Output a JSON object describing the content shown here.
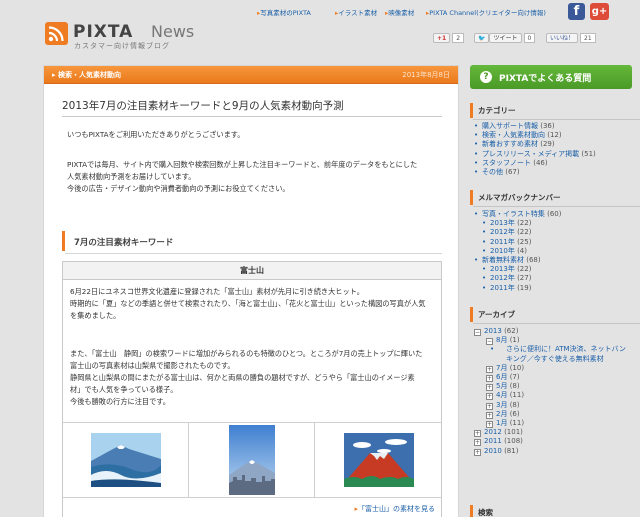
{
  "header": {
    "logo_text": "PIXTA",
    "logo_news": "News",
    "logo_sub": "カスタマー向け情報ブログ",
    "nav": [
      "写真素材のPIXTA",
      "イラスト素材",
      "映像素材",
      "PIXTA Channel(クリエイター向け情報)"
    ],
    "social": {
      "gplus_label": "+1",
      "gplus_count": "2",
      "tweet_label": "ツイート",
      "tweet_count": "0",
      "like_label": "いいね！",
      "like_count": "21"
    }
  },
  "article": {
    "category": "検索・人気素材動向",
    "date": "2013年8月8日",
    "title": "2013年7月の注目素材キーワードと9月の人気素材動向予測",
    "intro": [
      "いつもPIXTAをご利用いただきありがとうございます。"
    ],
    "body": [
      "PIXTAでは毎月、サイト内で購入回数や検索回数が上昇した注目キーワードと、前年度のデータをもとにした",
      "人気素材動向予測をお届けしています。",
      "今後の広告・デザイン動向や消費者動向の予測にお役立てください。"
    ],
    "section_title": "7月の注目素材キーワード",
    "box": {
      "heading": "富士山",
      "para1": [
        "6月22日にユネスコ世界文化遺産に登録された「富士山」素材が先月に引き続き大ヒット。",
        "時期的に「夏」などの季語と併せて検索されたり、「海と富士山」、「花火と富士山」といった構図の写真が人気",
        "を集めました。"
      ],
      "para2": [
        "また、「富士山　静岡」の検索ワードに増加がみられるのも特徴のひとつ。ところが7月の売上トップに輝いた",
        "富士山の写真素材は山梨県で撮影されたものです。",
        "静岡県と山梨県の間にまたがる富士山は、何かと両県の勝負の題材ですが、どうやら「富士山のイメージ素",
        "材」でも人気を争っている様子。",
        "今後も勝敗の行方に注目です。"
      ],
      "link": "「富士山」の素材を見る"
    }
  },
  "sidebar": {
    "faq": "PIXTAでよくある質問",
    "categories_heading": "カテゴリー",
    "categories": [
      {
        "name": "購入サポート情報",
        "count": "(36)"
      },
      {
        "name": "検索・人気素材動向",
        "count": "(12)"
      },
      {
        "name": "新着おすすめ素材",
        "count": "(29)"
      },
      {
        "name": "プレスリリース・メディア掲載",
        "count": "(51)"
      },
      {
        "name": "スタッフノート",
        "count": "(46)"
      },
      {
        "name": "その他",
        "count": "(67)"
      }
    ],
    "mailmag_heading": "メルマガバックナンバー",
    "mailmag": [
      {
        "name": "写真・イラスト特集",
        "count": "(60)",
        "level": 0
      },
      {
        "name": "2013年",
        "count": "(22)",
        "level": 1
      },
      {
        "name": "2012年",
        "count": "(22)",
        "level": 1
      },
      {
        "name": "2011年",
        "count": "(25)",
        "level": 1
      },
      {
        "name": "2010年",
        "count": "(4)",
        "level": 1
      },
      {
        "name": "新着無料素材",
        "count": "(68)",
        "level": 0
      },
      {
        "name": "2013年",
        "count": "(22)",
        "level": 1
      },
      {
        "name": "2012年",
        "count": "(27)",
        "level": 1
      },
      {
        "name": "2011年",
        "count": "(19)",
        "level": 1
      }
    ],
    "archive_heading": "アーカイブ",
    "archive": {
      "year": "2013",
      "year_count": "(62)",
      "month": "8月",
      "month_count": "(1)",
      "post": [
        "さらに便利に！ATM決済、ネットバン",
        "キング／今すぐ使える無料素材"
      ],
      "months": [
        {
          "name": "7月",
          "count": "(10)"
        },
        {
          "name": "6月",
          "count": "(7)"
        },
        {
          "name": "5月",
          "count": "(8)"
        },
        {
          "name": "4月",
          "count": "(11)"
        },
        {
          "name": "3月",
          "count": "(8)"
        },
        {
          "name": "2月",
          "count": "(6)"
        },
        {
          "name": "1月",
          "count": "(11)"
        }
      ],
      "years": [
        {
          "name": "2012",
          "count": "(101)"
        },
        {
          "name": "2011",
          "count": "(108)"
        },
        {
          "name": "2010",
          "count": "(81)"
        }
      ]
    },
    "search_heading": "検索"
  }
}
